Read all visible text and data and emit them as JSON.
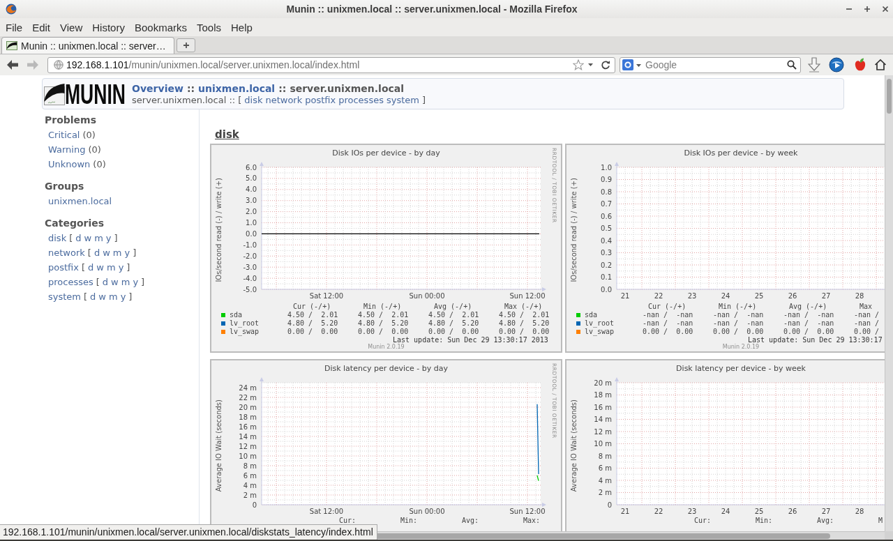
{
  "window": {
    "title": "Munin :: unixmen.local :: server.unixmen.local - Mozilla Firefox"
  },
  "menu": [
    "File",
    "Edit",
    "View",
    "History",
    "Bookmarks",
    "Tools",
    "Help"
  ],
  "tabs": [
    {
      "label": "Munin :: unixmen.local :: server…",
      "selected": true
    }
  ],
  "navigation": {
    "back": {
      "disabled": false
    },
    "forward": {
      "disabled": true
    }
  },
  "address_bar": {
    "host": "192.168.1.101",
    "path": "/munin/unixmen.local/server.unixmen.local/index.html"
  },
  "search": {
    "placeholder": "Google"
  },
  "header": {
    "logo": "MUNIN",
    "breadcrumb": [
      {
        "text": "Overview",
        "kind": "link"
      },
      {
        "text": "::",
        "kind": "separator"
      },
      {
        "text": "unixmen.local",
        "kind": "link"
      },
      {
        "text": "::",
        "kind": "separator"
      },
      {
        "text": "server.unixmen.local",
        "kind": "current"
      }
    ],
    "subtitle": {
      "host": "server.unixmen.local ::",
      "open": "[",
      "links": [
        "disk",
        "network",
        "postfix",
        "processes",
        "system"
      ],
      "close": "]"
    }
  },
  "sidebar": {
    "sections": [
      {
        "heading": "Problems",
        "items": [
          {
            "label": "Critical",
            "count": "(0)"
          },
          {
            "label": "Warning",
            "count": "(0)"
          },
          {
            "label": "Unknown",
            "count": "(0)"
          }
        ]
      },
      {
        "heading": "Groups",
        "items": [
          {
            "label": "unixmen.local"
          }
        ]
      },
      {
        "heading": "Categories",
        "items": [
          {
            "label": "disk",
            "open": "[",
            "periods": [
              "d",
              "w",
              "m",
              "y"
            ],
            "close": "]"
          },
          {
            "label": "network",
            "open": "[",
            "periods": [
              "d",
              "w",
              "m",
              "y"
            ],
            "close": "]"
          },
          {
            "label": "postfix",
            "open": "[",
            "periods": [
              "d",
              "w",
              "m",
              "y"
            ],
            "close": "]"
          },
          {
            "label": "processes",
            "open": "[",
            "periods": [
              "d",
              "w",
              "m",
              "y"
            ],
            "close": "]"
          },
          {
            "label": "system",
            "open": "[",
            "periods": [
              "d",
              "w",
              "m",
              "y"
            ],
            "close": "]"
          }
        ]
      }
    ]
  },
  "section": {
    "heading": "disk",
    "graphs": [
      {
        "chart_data": {
          "type": "line",
          "title": "Disk IOs per device - by day",
          "ylabel": "IOs/second read (-) / write (+)",
          "grid": true,
          "categories": [
            null,
            null,
            null,
            null,
            null,
            null,
            null,
            null,
            null,
            null,
            null,
            null,
            null,
            null,
            null,
            null,
            null,
            null,
            null,
            null,
            null,
            null,
            null,
            null,
            null,
            null,
            null,
            null,
            null,
            null,
            null,
            null,
            null,
            null,
            null,
            null,
            null,
            null,
            null,
            null,
            null,
            null,
            null,
            null,
            null,
            null,
            "Sat 12:00",
            null,
            null,
            null,
            null,
            null,
            null,
            null,
            null,
            null,
            null,
            null,
            null,
            null,
            null,
            null,
            null,
            null,
            null,
            null,
            null,
            null,
            null,
            null,
            null,
            null,
            null,
            null,
            null,
            null,
            null,
            null,
            null,
            null,
            null,
            null,
            null,
            null,
            null,
            null,
            null,
            null,
            null,
            null,
            null,
            null,
            null,
            null,
            null,
            null,
            null,
            null,
            null,
            null,
            null,
            null,
            null,
            null,
            null,
            null,
            null,
            null,
            null,
            null,
            null,
            null,
            null,
            null,
            null,
            null,
            null,
            null,
            "Sun 00:00",
            null,
            null,
            null,
            null,
            null,
            null,
            null,
            null,
            null,
            null,
            null,
            null,
            null,
            null,
            null,
            null,
            null,
            null,
            null,
            null,
            null,
            null,
            null,
            null,
            null,
            null,
            null,
            null,
            null,
            null,
            null,
            null,
            null,
            null,
            null,
            null,
            null,
            null,
            null,
            null,
            null,
            null,
            null,
            null,
            null,
            null,
            null,
            null,
            null,
            null,
            null,
            null,
            null,
            null,
            null,
            null,
            null,
            null,
            null,
            null,
            null,
            null,
            null,
            null,
            null,
            null,
            null,
            null,
            null,
            null,
            null,
            "Sun 12:00",
            null,
            null,
            null,
            null,
            null,
            null,
            null,
            null,
            null
          ],
          "ylim": [
            -5,
            6
          ],
          "yticks": [
            {
              "value": 6,
              "label": "6.0"
            },
            {
              "value": 5,
              "label": "5.0"
            },
            {
              "value": 4,
              "label": "4.0"
            },
            {
              "value": 3,
              "label": "3.0"
            },
            {
              "value": 2,
              "label": "2.0"
            },
            {
              "value": 1,
              "label": "1.0"
            },
            {
              "value": 0,
              "label": "0.0"
            },
            {
              "value": -1,
              "label": "-1.0"
            },
            {
              "value": -2,
              "label": "-2.0"
            },
            {
              "value": -3,
              "label": "-3.0"
            },
            {
              "value": -4,
              "label": "-4.0"
            },
            {
              "value": -5,
              "label": "-5.0"
            }
          ],
          "ref_lines": [
            {
              "axis": "y",
              "value": 0,
              "color": "#000000"
            }
          ]
        },
        "legend": {
          "kind": "paired",
          "columns": [
            "Cur (-/+)",
            "Min (-/+)",
            "Avg (-/+)",
            "Max (-/+)"
          ],
          "rows": [
            {
              "name": "sda",
              "color": "#00cc00",
              "values": [
                "4.50 /  2.01",
                "4.50 /  2.01",
                "4.50 /  2.01",
                "4.50 /  2.01"
              ]
            },
            {
              "name": "lv_root",
              "color": "#0066b3",
              "values": [
                "4.80 /  5.20",
                "4.80 /  5.20",
                "4.80 /  5.20",
                "4.80 /  5.20"
              ]
            },
            {
              "name": "lv_swap",
              "color": "#ff8000",
              "values": [
                "0.00 /  0.00",
                "0.00 /  0.00",
                "0.00 /  0.00",
                "0.00 /  0.00"
              ]
            }
          ]
        },
        "last_update": "Last update: Sun Dec 29 13:30:17 2013",
        "credit": "RRDTOOL / TOBI OETIKER",
        "version": "Munin 2.0.19"
      },
      {
        "chart_data": {
          "type": "line",
          "title": "Disk IOs per device - by week",
          "ylabel": "IOs/second read (-) / write (+)",
          "grid": true,
          "xlim": [
            21.25,
            29.25
          ],
          "ylim": [
            0,
            1
          ],
          "xticks": [
            {
              "value": 21.5,
              "label": "21"
            },
            {
              "value": 22.5,
              "label": "22"
            },
            {
              "value": 23.5,
              "label": "23"
            },
            {
              "value": 24.5,
              "label": "24"
            },
            {
              "value": 25.5,
              "label": "25"
            },
            {
              "value": 26.5,
              "label": "26"
            },
            {
              "value": 27.5,
              "label": "27"
            },
            {
              "value": 28.5,
              "label": "28"
            }
          ],
          "yticks": [
            {
              "value": 1,
              "label": "1.0"
            },
            {
              "value": 0.9,
              "label": "0.9"
            },
            {
              "value": 0.8,
              "label": "0.8"
            },
            {
              "value": 0.7,
              "label": "0.7"
            },
            {
              "value": 0.6,
              "label": "0.6"
            },
            {
              "value": 0.5,
              "label": "0.5"
            },
            {
              "value": 0.4,
              "label": "0.4"
            },
            {
              "value": 0.3,
              "label": "0.3"
            },
            {
              "value": 0.2,
              "label": "0.2"
            },
            {
              "value": 0.1,
              "label": "0.1"
            },
            {
              "value": 0,
              "label": "0.0"
            }
          ]
        },
        "legend": {
          "kind": "paired",
          "columns": [
            "Cur (-/+)",
            "Min (-/+)",
            "Avg (-/+)",
            "Max"
          ],
          "rows": [
            {
              "name": "sda",
              "color": "#00cc00",
              "values": [
                "-nan /  -nan",
                "-nan /  -nan",
                "-nan /  -nan",
                "-nan /"
              ]
            },
            {
              "name": "lv_root",
              "color": "#0066b3",
              "values": [
                "-nan /  -nan",
                "-nan /  -nan",
                "-nan /  -nan",
                "-nan /"
              ]
            },
            {
              "name": "lv_swap",
              "color": "#ff8000",
              "values": [
                "0.00 /  0.00",
                "0.00 /  0.00",
                "0.00 /  0.00",
                "0.00 /"
              ]
            }
          ]
        },
        "last_update": "Last update: Sun Dec 29 13:30:17",
        "version": "Munin 2.0.19"
      },
      {
        "chart_data": {
          "type": "line",
          "title": "Disk latency per device - by day",
          "ylabel": "Average IO Wait (seconds)",
          "grid": true,
          "categories": [
            null,
            null,
            null,
            null,
            null,
            null,
            null,
            null,
            null,
            null,
            null,
            null,
            null,
            null,
            null,
            null,
            null,
            null,
            null,
            null,
            null,
            null,
            null,
            null,
            null,
            null,
            null,
            null,
            null,
            null,
            null,
            null,
            null,
            null,
            null,
            null,
            null,
            null,
            null,
            null,
            null,
            null,
            null,
            null,
            null,
            null,
            "Sat 12:00",
            null,
            null,
            null,
            null,
            null,
            null,
            null,
            null,
            null,
            null,
            null,
            null,
            null,
            null,
            null,
            null,
            null,
            null,
            null,
            null,
            null,
            null,
            null,
            null,
            null,
            null,
            null,
            null,
            null,
            null,
            null,
            null,
            null,
            null,
            null,
            null,
            null,
            null,
            null,
            null,
            null,
            null,
            null,
            null,
            null,
            null,
            null,
            null,
            null,
            null,
            null,
            null,
            null,
            null,
            null,
            null,
            null,
            null,
            null,
            null,
            null,
            null,
            null,
            null,
            null,
            null,
            null,
            null,
            null,
            null,
            null,
            "Sun 00:00",
            null,
            null,
            null,
            null,
            null,
            null,
            null,
            null,
            null,
            null,
            null,
            null,
            null,
            null,
            null,
            null,
            null,
            null,
            null,
            null,
            null,
            null,
            null,
            null,
            null,
            null,
            null,
            null,
            null,
            null,
            null,
            null,
            null,
            null,
            null,
            null,
            null,
            null,
            null,
            null,
            null,
            null,
            null,
            null,
            null,
            null,
            null,
            null,
            null,
            null,
            null,
            null,
            null,
            null,
            null,
            null,
            null,
            null,
            null,
            null,
            null,
            null,
            null,
            null,
            null,
            null,
            null,
            null,
            null,
            null,
            null,
            "Sun 12:00",
            null,
            null,
            null,
            null,
            null,
            null,
            null,
            null,
            null
          ],
          "ylim": [
            0,
            25
          ],
          "series": [
            {
              "color": "#00cc00",
              "values": [
                null,
                null,
                null,
                null,
                null,
                null,
                null,
                null,
                null,
                null,
                null,
                null,
                null,
                null,
                null,
                null,
                null,
                null,
                null,
                null,
                null,
                null,
                null,
                null,
                null,
                null,
                null,
                null,
                null,
                null,
                null,
                null,
                null,
                null,
                null,
                null,
                null,
                null,
                null,
                null,
                null,
                null,
                null,
                null,
                null,
                null,
                null,
                null,
                null,
                null,
                null,
                null,
                null,
                null,
                null,
                null,
                null,
                null,
                null,
                null,
                null,
                null,
                null,
                null,
                null,
                null,
                null,
                null,
                null,
                null,
                null,
                null,
                null,
                null,
                null,
                null,
                null,
                null,
                null,
                null,
                null,
                null,
                null,
                null,
                null,
                null,
                null,
                null,
                null,
                null,
                null,
                null,
                null,
                null,
                null,
                null,
                null,
                null,
                null,
                null,
                null,
                null,
                null,
                null,
                null,
                null,
                null,
                null,
                null,
                null,
                null,
                null,
                null,
                null,
                null,
                null,
                null,
                null,
                null,
                null,
                null,
                null,
                null,
                null,
                null,
                null,
                null,
                null,
                null,
                null,
                null,
                null,
                null,
                null,
                null,
                null,
                null,
                null,
                null,
                null,
                null,
                null,
                null,
                null,
                null,
                null,
                null,
                null,
                null,
                null,
                null,
                null,
                null,
                null,
                null,
                null,
                null,
                null,
                null,
                null,
                null,
                null,
                null,
                null,
                null,
                null,
                null,
                null,
                null,
                null,
                null,
                null,
                null,
                null,
                null,
                null,
                null,
                null,
                null,
                null,
                null,
                null,
                null,
                null,
                null,
                null,
                null,
                null,
                null,
                null,
                null,
                null,
                null,
                null,
                null,
                null,
                null,
                6,
                4.9,
                null
              ]
            },
            {
              "color": "#0066b3",
              "values": [
                null,
                null,
                null,
                null,
                null,
                null,
                null,
                null,
                null,
                null,
                null,
                null,
                null,
                null,
                null,
                null,
                null,
                null,
                null,
                null,
                null,
                null,
                null,
                null,
                null,
                null,
                null,
                null,
                null,
                null,
                null,
                null,
                null,
                null,
                null,
                null,
                null,
                null,
                null,
                null,
                null,
                null,
                null,
                null,
                null,
                null,
                null,
                null,
                null,
                null,
                null,
                null,
                null,
                null,
                null,
                null,
                null,
                null,
                null,
                null,
                null,
                null,
                null,
                null,
                null,
                null,
                null,
                null,
                null,
                null,
                null,
                null,
                null,
                null,
                null,
                null,
                null,
                null,
                null,
                null,
                null,
                null,
                null,
                null,
                null,
                null,
                null,
                null,
                null,
                null,
                null,
                null,
                null,
                null,
                null,
                null,
                null,
                null,
                null,
                null,
                null,
                null,
                null,
                null,
                null,
                null,
                null,
                null,
                null,
                null,
                null,
                null,
                null,
                null,
                null,
                null,
                null,
                null,
                null,
                null,
                null,
                null,
                null,
                null,
                null,
                null,
                null,
                null,
                null,
                null,
                null,
                null,
                null,
                null,
                null,
                null,
                null,
                null,
                null,
                null,
                null,
                null,
                null,
                null,
                null,
                null,
                null,
                null,
                null,
                null,
                null,
                null,
                null,
                null,
                null,
                null,
                null,
                null,
                null,
                null,
                null,
                null,
                null,
                null,
                null,
                null,
                null,
                null,
                null,
                null,
                null,
                null,
                null,
                null,
                null,
                null,
                null,
                null,
                null,
                null,
                null,
                null,
                null,
                null,
                null,
                null,
                null,
                null,
                null,
                null,
                null,
                null,
                null,
                null,
                null,
                null,
                null,
                20.6,
                6.3,
                null
              ]
            }
          ],
          "yticks": [
            {
              "value": 24,
              "label": "24 m"
            },
            {
              "value": 22,
              "label": "22 m"
            },
            {
              "value": 20,
              "label": "20 m"
            },
            {
              "value": 18,
              "label": "18 m"
            },
            {
              "value": 16,
              "label": "16 m"
            },
            {
              "value": 14,
              "label": "14 m"
            },
            {
              "value": 12,
              "label": "12 m"
            },
            {
              "value": 10,
              "label": "10 m"
            },
            {
              "value": 8,
              "label": "8 m"
            },
            {
              "value": 6,
              "label": "6 m"
            },
            {
              "value": 4,
              "label": "4 m"
            },
            {
              "value": 2,
              "label": "2 m"
            },
            {
              "value": 0,
              "label": "0"
            }
          ]
        },
        "legend": {
          "kind": "single",
          "columns": [
            "Cur:",
            "Min:",
            "Avg:",
            "Max:"
          ]
        },
        "credit": "RRDTOOL / TOBI OETIKER"
      },
      {
        "chart_data": {
          "type": "line",
          "title": "Disk latency per device - by week",
          "ylabel": "Average IO Wait (seconds)",
          "grid": true,
          "xlim": [
            21.25,
            29.25
          ],
          "ylim": [
            0,
            20
          ],
          "xticks": [
            {
              "value": 21.5,
              "label": "21"
            },
            {
              "value": 22.5,
              "label": "22"
            },
            {
              "value": 23.5,
              "label": "23"
            },
            {
              "value": 24.5,
              "label": "24"
            },
            {
              "value": 25.5,
              "label": "25"
            },
            {
              "value": 26.5,
              "label": "26"
            },
            {
              "value": 27.5,
              "label": "27"
            },
            {
              "value": 28.5,
              "label": "28"
            }
          ],
          "yticks": [
            {
              "value": 20,
              "label": "20 m"
            },
            {
              "value": 18,
              "label": "18 m"
            },
            {
              "value": 16,
              "label": "16 m"
            },
            {
              "value": 14,
              "label": "14 m"
            },
            {
              "value": 12,
              "label": "12 m"
            },
            {
              "value": 10,
              "label": "10 m"
            },
            {
              "value": 8,
              "label": "8 m"
            },
            {
              "value": 6,
              "label": "6 m"
            },
            {
              "value": 4,
              "label": "4 m"
            },
            {
              "value": 2,
              "label": "2 m"
            },
            {
              "value": 0,
              "label": "0"
            }
          ]
        },
        "legend": {
          "kind": "single",
          "columns": [
            "Cur:",
            "Min:",
            "Avg:",
            "M"
          ]
        }
      }
    ]
  },
  "status_link": "192.168.1.101/munin/unixmen.local/server.unixmen.local/diskstats_latency/index.html"
}
